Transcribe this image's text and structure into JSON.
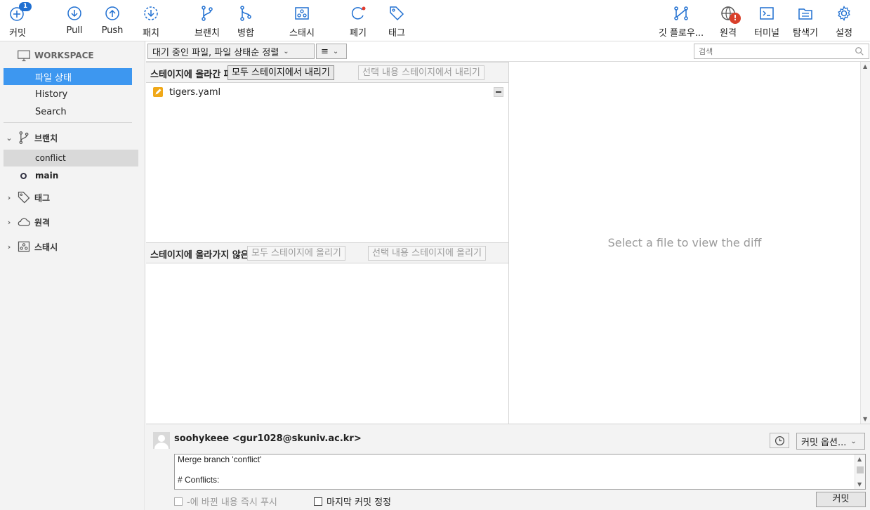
{
  "toolbar": {
    "commit_label": "커밋",
    "commit_badge": "1",
    "pull_label": "Pull",
    "push_label": "Push",
    "fetch_label": "패치",
    "branch_label": "브랜치",
    "merge_label": "병합",
    "stash_label": "스태시",
    "discard_label": "폐기",
    "tag_label": "태그",
    "gitflow_label": "깃 플로우...",
    "remote_label": "원격",
    "remote_badge": "!",
    "terminal_label": "터미널",
    "explorer_label": "탐색기",
    "settings_label": "설정"
  },
  "sidebar": {
    "workspace_label": "WORKSPACE",
    "workspace_items": [
      "파일 상태",
      "History",
      "Search"
    ],
    "branches_label": "브랜치",
    "branches": [
      "conflict",
      "main"
    ],
    "tags_label": "태그",
    "remotes_label": "원격",
    "stashes_label": "스태시"
  },
  "filter": {
    "status_filter": "대기 중인 파일, 파일 상태순 정렬",
    "view_mode_icon": "≡",
    "search_placeholder": "검색"
  },
  "staged": {
    "title": "스테이지에 올라간 파일",
    "unstage_all": "모두 스테이지에서 내리기",
    "unstage_selected": "선택 내용 스테이지에서 내리기",
    "files": [
      {
        "name": "tigers.yaml",
        "status": "modified"
      }
    ]
  },
  "unstaged": {
    "title": "스테이지에 올라가지 않은 파일",
    "stage_all": "모두 스테이지에 올리기",
    "stage_selected": "선택 내용 스테이지에 올리기"
  },
  "diff": {
    "placeholder": "Select a file to view the diff"
  },
  "commit": {
    "author": "soohykeee <gur1028@skuniv.ac.kr>",
    "options_label": "커밋 옵션...",
    "message_lines": [
      "Merge branch 'conflict'",
      "",
      "# Conflicts:"
    ],
    "push_immediately": "-에 바뀐 내용 즉시 푸시",
    "amend_last": "마지막 커밋 정정",
    "commit_button": "커밋"
  },
  "colors": {
    "accent": "#3d97f0",
    "badge": "#1f6fd1",
    "warning": "#d9402b",
    "modified_icon": "#f0a818"
  }
}
